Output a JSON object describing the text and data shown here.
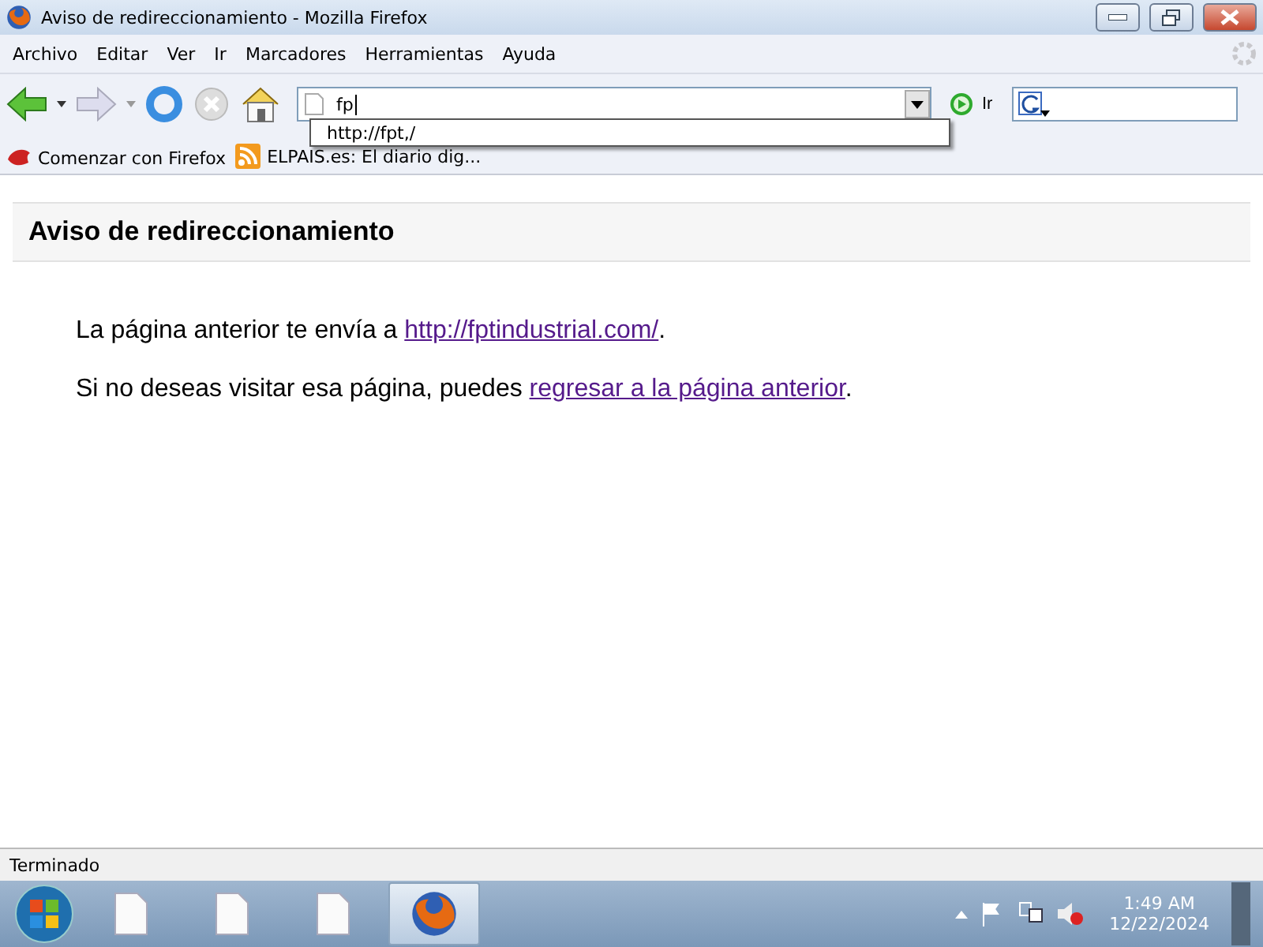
{
  "window": {
    "title": "Aviso de redireccionamiento - Mozilla Firefox"
  },
  "menu": [
    "Archivo",
    "Editar",
    "Ver",
    "Ir",
    "Marcadores",
    "Herramientas",
    "Ayuda"
  ],
  "address": {
    "value": "fp",
    "suggestions": [
      "http://fpt,/"
    ]
  },
  "go_label": "Ir",
  "bookmarks": [
    {
      "kind": "firefox",
      "label": "Comenzar con Firefox"
    },
    {
      "kind": "feed",
      "label": "ELPAIS.es: El diario dig..."
    }
  ],
  "page": {
    "heading": "Aviso de redireccionamiento",
    "paragraphs": [
      {
        "text": "La página anterior te envía a ",
        "link": "http://fptindustrial.com/",
        "after": "."
      },
      {
        "text": "Si no deseas visitar esa página, puedes ",
        "link": "regresar a la página anterior",
        "after": "."
      }
    ]
  },
  "status": "Terminado",
  "taskbar": [
    {
      "kind": "document",
      "selected": false
    },
    {
      "kind": "document",
      "selected": false
    },
    {
      "kind": "document",
      "selected": false
    },
    {
      "kind": "firefox",
      "selected": true
    }
  ],
  "clock": {
    "time": "1:49 AM",
    "date": "12/22/2024"
  }
}
